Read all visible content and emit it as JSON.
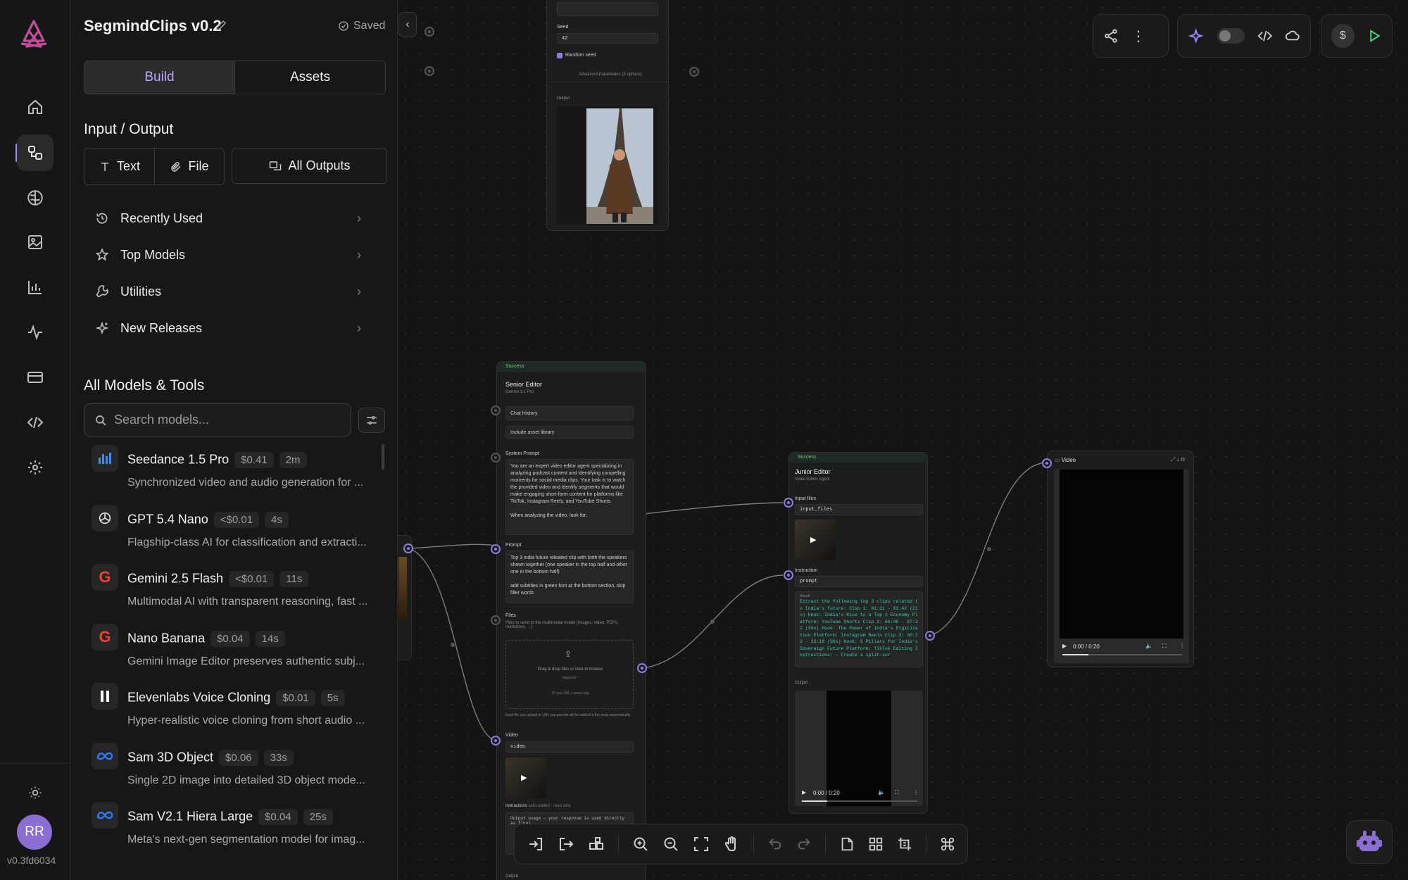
{
  "app": {
    "project_name": "SegmindClips v0.2",
    "saved_label": "Saved",
    "version": "v0.3fd6034",
    "user_initials": "RR"
  },
  "tabs": [
    {
      "label": "Build"
    },
    {
      "label": "Assets"
    }
  ],
  "io": {
    "heading": "Input / Output",
    "text": "Text",
    "file": "File",
    "all_outputs": "All Outputs"
  },
  "categories": [
    {
      "label": "Recently Used",
      "icon": "history-icon"
    },
    {
      "label": "Top Models",
      "icon": "star-icon"
    },
    {
      "label": "Utilities",
      "icon": "wrench-icon"
    },
    {
      "label": "New Releases",
      "icon": "sparkles-icon"
    }
  ],
  "models_heading": "All Models & Tools",
  "search": {
    "placeholder": "Search models..."
  },
  "models": [
    {
      "name": "Seedance 1.5 Pro",
      "price": "$0.41",
      "time": "2m",
      "desc": "Synchronized video and audio generation for ...",
      "icon": "bars-icon",
      "icon_color": "#3a8cff"
    },
    {
      "name": "GPT 5.4 Nano",
      "price": "<$0.01",
      "time": "4s",
      "desc": "Flagship-class AI for classification and extracti...",
      "icon": "openai-icon",
      "icon_color": "#e0e0e0"
    },
    {
      "name": "Gemini 2.5 Flash",
      "price": "<$0.01",
      "time": "11s",
      "desc": "Multimodal AI with transparent reasoning, fast ...",
      "icon": "google-icon",
      "icon_color": "#ea4335"
    },
    {
      "name": "Nano Banana",
      "price": "$0.04",
      "time": "14s",
      "desc": "Gemini Image Editor preserves authentic subj...",
      "icon": "google-icon",
      "icon_color": "#ea4335"
    },
    {
      "name": "Elevenlabs Voice Cloning",
      "price": "$0.01",
      "time": "5s",
      "desc": "Hyper-realistic voice cloning from short audio ...",
      "icon": "elevenlabs-icon",
      "icon_color": "#ffffff"
    },
    {
      "name": "Sam 3D Object",
      "price": "$0.06",
      "time": "33s",
      "desc": "Single 2D image into detailed 3D object mode...",
      "icon": "meta-icon",
      "icon_color": "#2d7bff"
    },
    {
      "name": "Sam V2.1 Hiera Large",
      "price": "$0.04",
      "time": "25s",
      "desc": "Meta's next-gen segmentation model for imag...",
      "icon": "meta-icon",
      "icon_color": "#2d7bff"
    }
  ],
  "top_node": {
    "seed_label": "Seed",
    "seed_value": "42",
    "random_seed": "Random seed",
    "advanced": "Advanced Parameters (3 options)",
    "output_label": "Output"
  },
  "senior_editor": {
    "status": "Success",
    "title": "Senior Editor",
    "subtitle": "Gemini 3.1 Pro",
    "chat_history": "Chat History",
    "include_asset": "Include asset library",
    "system_prompt_label": "System Prompt",
    "system_prompt": "You are an expert video editor agent specializing in analyzing podcast content and identifying compelling moments for social media clips. Your task is to watch the provided video and identify segments that would make engaging short-form content for platforms like TikTok, Instagram Reels, and YouTube Shorts.",
    "system_prompt_2": "When analyzing the video, look for:",
    "prompt_label": "Prompt",
    "prompt": "Top 3 india future releated clip with both the speakers shown together (one speaker in the top half and other one in the bottom half)",
    "prompt_2": "add subtitles in green font at the bottom section, skip filler words",
    "files_label": "Files",
    "files_help": "Files to send to the multimodal model (images, video, PDFs, markdown, ...)",
    "drop_text": "Drag & drop files or click to browse",
    "supports": "Supports *",
    "or_url": "Or use URL / asset slug",
    "each_file": "Each file you upload or URL you provide will be added to the array automatically.",
    "video_label": "Video",
    "video_tag": "video",
    "instructions_label": "Instructions",
    "instructions_note": "auto-added · read only",
    "instructions": "Output usage — your response is used directly as final...",
    "output_label": "Output"
  },
  "junior_editor": {
    "status": "Success",
    "title": "Junior Editor",
    "subtitle": "Video Editor Agent",
    "input_files_label": "Input files",
    "input_files_tag": "input_files",
    "instruction_label": "Instruction",
    "instruction_tag": "prompt",
    "result_label": "Result",
    "result": "Extract the following top 3 clips related to India's future: Clip 1: 01:21 - 01:42 (21s) Hook: India's Rise to a Top 3 Economy Platform: YouTube Shorts Clip 2: 06:48 - 07:22 (34s) Hook: The Power of India's Digitization Platform: Instagram Reels Clip 3: 30:23 - 33:18 (56s) Hook: 5 Pillars for India's Sovereign Future Platform: TikTok Editing Instructions: - Create a split-scr",
    "output_label": "Output",
    "player_time": "0:00 / 0:20"
  },
  "video_node": {
    "title": "Video",
    "player_time": "0:00 / 0:20"
  },
  "colors": {
    "accent": "#9a8cff",
    "success": "#6fcf97",
    "run": "#3ddc84",
    "port": "#8f7ddc"
  }
}
